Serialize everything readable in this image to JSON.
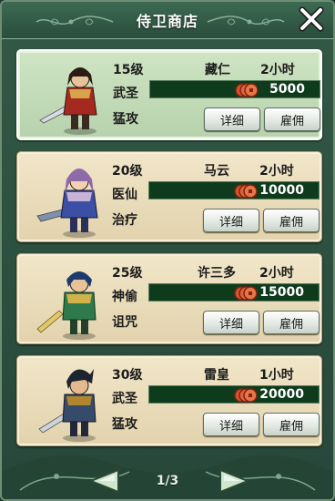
{
  "title": "侍卫商店",
  "guards": [
    {
      "level": "15级",
      "trait1": "武圣",
      "trait2": "猛攻",
      "name": "藏仁",
      "duration": "2小时",
      "price": "5000",
      "details_label": "详细",
      "hire_label": "雇佣",
      "selected": true,
      "palette": {
        "hair": "#2a1c14",
        "body": "#a6291f",
        "armor": "#d6a44a",
        "blade": "#d8dde4"
      }
    },
    {
      "level": "20级",
      "trait1": "医仙",
      "trait2": "治疗",
      "name": "马云",
      "duration": "2小时",
      "price": "10000",
      "details_label": "详细",
      "hire_label": "雇佣",
      "selected": false,
      "palette": {
        "hair": "#8f6aa8",
        "body": "#3b4fa5",
        "armor": "#c7b3d6",
        "blade": "#7f8fb0"
      }
    },
    {
      "level": "25级",
      "trait1": "神偷",
      "trait2": "诅咒",
      "name": "许三多",
      "duration": "2小时",
      "price": "15000",
      "details_label": "详细",
      "hire_label": "雇佣",
      "selected": false,
      "palette": {
        "hair": "#1f3b6e",
        "body": "#2f7a4d",
        "armor": "#d1b24a",
        "blade": "#e0c76a"
      }
    },
    {
      "level": "30级",
      "trait1": "武圣",
      "trait2": "猛攻",
      "name": "雷皇",
      "duration": "1小时",
      "price": "20000",
      "details_label": "详细",
      "hire_label": "雇佣",
      "selected": false,
      "palette": {
        "hair": "#1c2430",
        "body": "#364a6a",
        "armor": "#b2852f",
        "blade": "#cfd4da"
      }
    }
  ],
  "pagination": {
    "label": "1/3"
  },
  "colors": {
    "panel": "#2d5240",
    "card": "#e9dcbc",
    "card_selected": "#c6dcb9",
    "price_bar": "#0f3b1d",
    "coin": "#d8542f"
  }
}
